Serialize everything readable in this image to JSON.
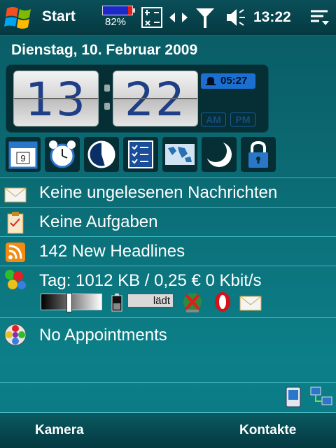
{
  "statusbar": {
    "start_label": "Start",
    "battery_percent": "82%",
    "time": "13:22"
  },
  "today": {
    "date": "Dienstag, 10. Februar 2009",
    "clock_hours": "13",
    "clock_minutes": "22",
    "alarm_time": "05:27",
    "am_label": "AM",
    "pm_label": "PM"
  },
  "rows": {
    "messages": "Keine ungelesenen Nachrichten",
    "tasks": "Keine Aufgaben",
    "headlines": "142 New Headlines",
    "traffic": "Tag: 1012 KB / 0,25 €  0 Kbit/s",
    "charging": "lädt",
    "appointments": "No Appointments"
  },
  "launcher_icons": [
    "calendar-icon",
    "alarm-clock-icon",
    "timer-icon",
    "tasks-icon",
    "world-map-icon",
    "moon-icon",
    "lock-icon"
  ],
  "softkeys": {
    "left": "Kamera",
    "right": "Kontakte"
  }
}
